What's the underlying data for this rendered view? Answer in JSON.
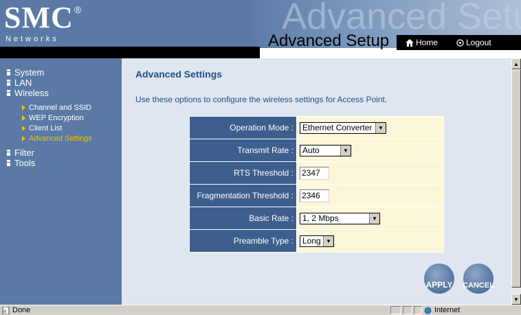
{
  "header": {
    "logo": "SMC",
    "logo_mark": "®",
    "logo_sub": "Networks",
    "watermark": "Advanced Setup",
    "title": "Advanced Setup",
    "home_label": "Home",
    "logout_label": "Logout"
  },
  "sidebar": {
    "items": [
      {
        "label": "System"
      },
      {
        "label": "LAN"
      },
      {
        "label": "Wireless"
      },
      {
        "label": "Filter"
      },
      {
        "label": "Tools"
      }
    ],
    "subitems": [
      {
        "label": "Channel and SSID"
      },
      {
        "label": "WEP Encryption"
      },
      {
        "label": "Client List"
      },
      {
        "label": "Advanced Settings"
      }
    ]
  },
  "main": {
    "title": "Advanced Settings",
    "description": "Use these options to configure the wireless settings for Access Point.",
    "rows": [
      {
        "label": "Operation Mode :",
        "type": "select",
        "value": "Ethernet Converter"
      },
      {
        "label": "Transmit Rate :",
        "type": "select",
        "value": "Auto"
      },
      {
        "label": "RTS Threshold :",
        "type": "input",
        "value": "2347"
      },
      {
        "label": "Fragmentation Threshold :",
        "type": "input",
        "value": "2346"
      },
      {
        "label": "Basic Rate :",
        "type": "select",
        "value": "1, 2 Mbps"
      },
      {
        "label": "Preamble Type :",
        "type": "select",
        "value": "Long"
      }
    ],
    "apply_label": "APPLY",
    "cancel_label": "CANCEL"
  },
  "statusbar": {
    "status": "Done",
    "zone": "Internet"
  },
  "colors": {
    "sidebar_bg": "#5a7aa5",
    "label_cell_bg": "#3d5f8e",
    "value_cell_bg": "#fdf7d9",
    "content_bg": "#dfe6f0",
    "active_nav": "#f2c200"
  }
}
